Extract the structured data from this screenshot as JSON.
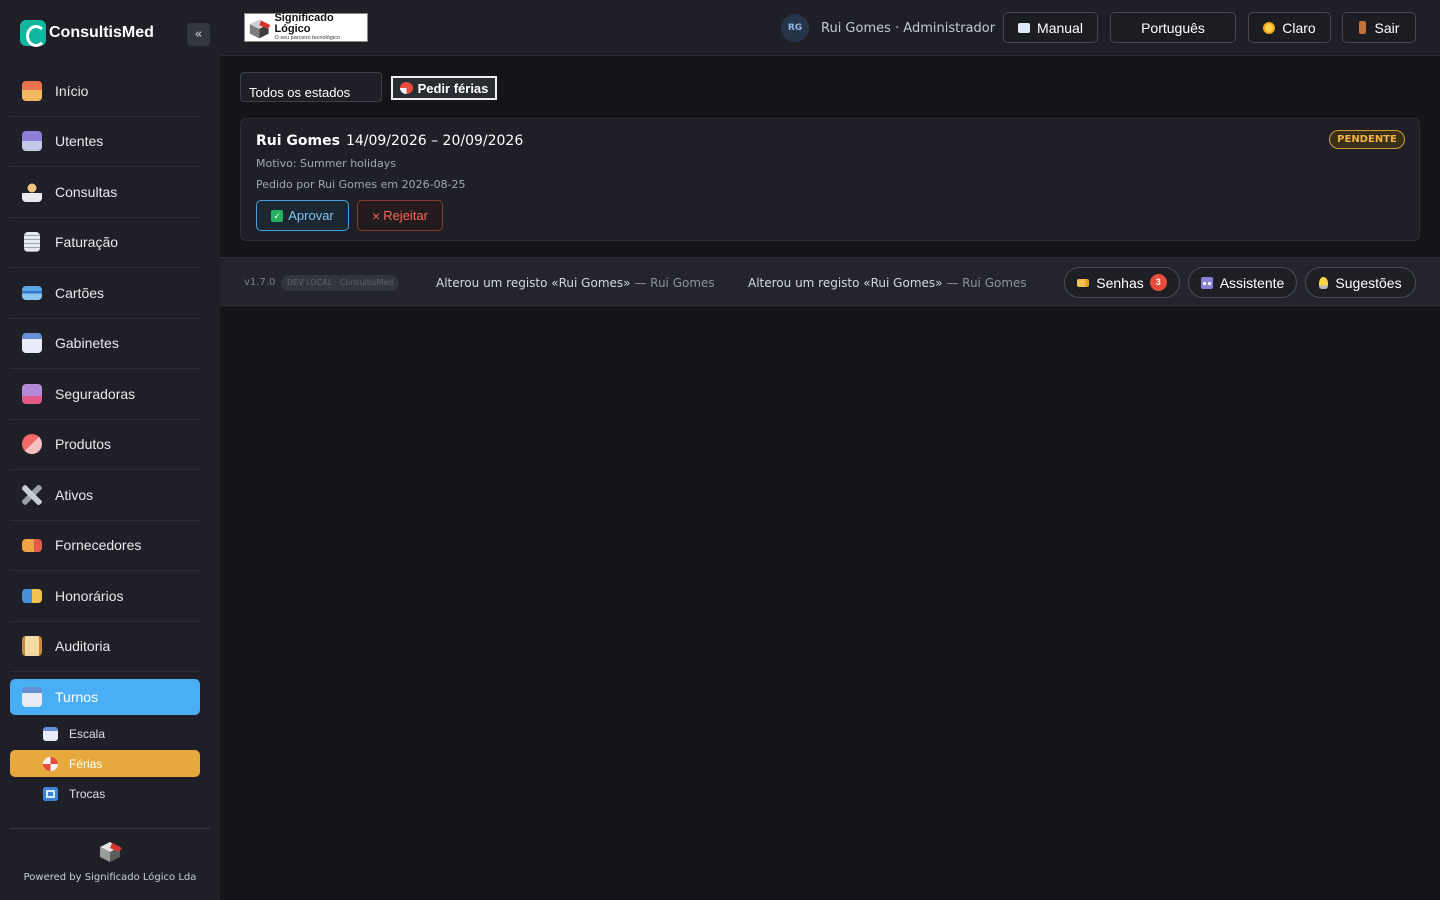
{
  "brand": {
    "name": "ConsultisMed",
    "collapse_label": "«"
  },
  "sidebar": {
    "items": [
      {
        "label": "Início",
        "icon": "house-icon"
      },
      {
        "label": "Utentes",
        "icon": "patients-icon"
      },
      {
        "label": "Consultas",
        "icon": "doctor-icon"
      },
      {
        "label": "Faturação",
        "icon": "receipt-icon"
      },
      {
        "label": "Cartões",
        "icon": "card-icon"
      },
      {
        "label": "Gabinetes",
        "icon": "calendar-icon"
      },
      {
        "label": "Seguradoras",
        "icon": "insurance-icon"
      },
      {
        "label": "Produtos",
        "icon": "pill-icon"
      },
      {
        "label": "Ativos",
        "icon": "tools-icon"
      },
      {
        "label": "Fornecedores",
        "icon": "truck-icon"
      },
      {
        "label": "Honorários",
        "icon": "money-icon"
      },
      {
        "label": "Auditoria",
        "icon": "scroll-icon"
      }
    ],
    "active": {
      "label": "Turnos",
      "icon": "calendar-icon"
    },
    "subitems": [
      {
        "label": "Escala",
        "icon": "calendar-icon"
      },
      {
        "label": "Férias",
        "icon": "beach-umbrella-icon"
      },
      {
        "label": "Trocas",
        "icon": "swap-icon"
      }
    ],
    "powered_by": "Powered by Significado Lógico Lda"
  },
  "header": {
    "company_logo": {
      "title": "Significado Lógico",
      "tagline": "O seu parceiro tecnológico"
    },
    "avatar_initials": "RG",
    "user": "Rui Gomes · Administrador",
    "manual_label": "Manual",
    "language_label": "Português",
    "theme_label": "Claro",
    "logout_label": "Sair"
  },
  "main": {
    "filter_value": "Todos os estados",
    "request_button": "Pedir férias",
    "request": {
      "name": "Rui Gomes",
      "dates": "14/09/2026 – 20/09/2026",
      "reason": "Motivo: Summer holidays",
      "requested_by": "Pedido por Rui Gomes em 2026-08-25",
      "status": "PENDENTE",
      "approve_label": "Aprovar",
      "reject_label": "Rejeitar"
    }
  },
  "footer": {
    "version": "v1.7.0",
    "env": "DEV LOCAL · ConsultisMed",
    "activities": [
      {
        "text": "Alterou um registo «Rui Gomes»",
        "who": "— Rui Gomes"
      },
      {
        "text": "Alterou um registo «Rui Gomes»",
        "who": "— Rui Gomes"
      }
    ],
    "tickets_label": "Senhas",
    "tickets_count": "3",
    "assistant_label": "Assistente",
    "suggestions_label": "Sugestões"
  },
  "colors": {
    "accent": "#4aaef5",
    "active_sub": "#e7a93e",
    "pending": "#f2b440",
    "reject": "#ef6a5c"
  }
}
